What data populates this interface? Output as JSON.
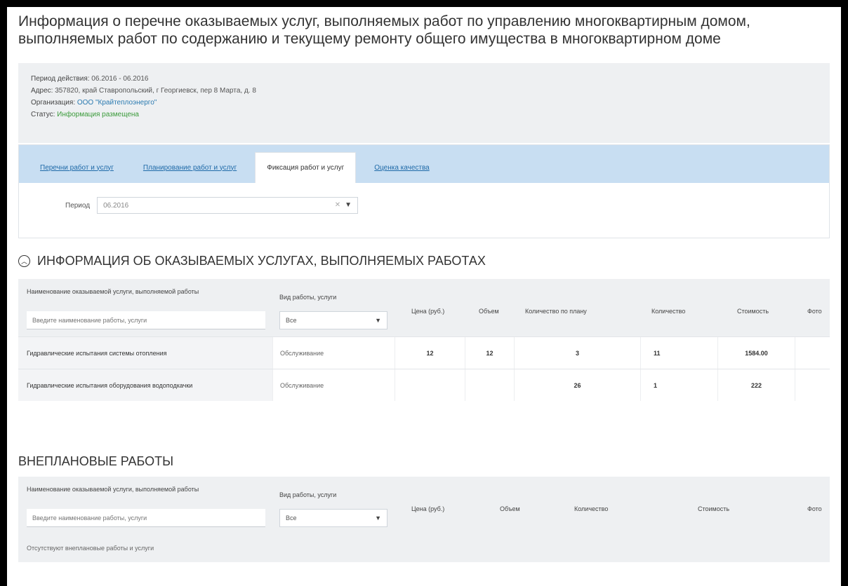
{
  "page": {
    "title": "Информация о перечне оказываемых услуг, выполняемых работ по управлению многоквартирным домом, выполняемых работ по содержанию и текущему ремонту общего имущества в многоквартирном доме"
  },
  "info": {
    "period_key": "Период действия:",
    "period_value": "06.2016 - 06.2016",
    "address_key": "Адрес:",
    "address_value": "357820, край Ставропольский, г Георгиевск, пер 8 Марта, д. 8",
    "org_key": "Организация:",
    "org_value": "ООО \"Крайтеплоэнерго\"",
    "status_key": "Статус:",
    "status_value": "Информация размещена"
  },
  "tabs": [
    {
      "label": "Перечни работ и услуг",
      "active": false
    },
    {
      "label": "Планирование работ и услуг",
      "active": false
    },
    {
      "label": "Фиксация работ и услуг",
      "active": true
    },
    {
      "label": "Оценка качества",
      "active": false
    }
  ],
  "period_filter": {
    "label": "Период",
    "value": "06.2016"
  },
  "services": {
    "heading": "ИНФОРМАЦИЯ ОБ ОКАЗЫВАЕМЫХ УСЛУГАХ, ВЫПОЛНЯЕМЫХ РАБОТАХ",
    "col_name": "Наименование оказываемой услуги, выполняемой работы",
    "col_type": "Вид работы, услуги",
    "col_price": "Цена (руб.)",
    "col_volume": "Объем",
    "col_qty_plan": "Количество по плану",
    "col_qty": "Количество",
    "col_cost": "Стоимость",
    "col_photo": "Фото",
    "search_placeholder": "Введите наименование работы, услуги",
    "type_filter": "Все",
    "rows": [
      {
        "name": "Гидравлические испытания системы отопления",
        "type": "Обслуживание",
        "price": "12",
        "volume": "12",
        "qty_plan": "3",
        "qty": "11",
        "cost": "1584.00"
      },
      {
        "name": "Гидравлические испытания оборудования водоподкачки",
        "type": "Обслуживание",
        "price": "",
        "volume": "",
        "qty_plan": "26",
        "qty": "1",
        "cost": "222"
      }
    ]
  },
  "unplanned": {
    "heading": "ВНЕПЛАНОВЫЕ РАБОТЫ",
    "col_name": "Наименование оказываемой услуги, выполняемой работы",
    "col_type": "Вид работы, услуги",
    "col_price": "Цена (руб.)",
    "col_volume": "Объем",
    "col_qty": "Количество",
    "col_cost": "Стоимость",
    "col_photo": "Фото",
    "search_placeholder": "Введите наименование работы, услуги",
    "type_filter": "Все",
    "empty_text": "Отсутствуют внеплановые работы и услуги"
  }
}
